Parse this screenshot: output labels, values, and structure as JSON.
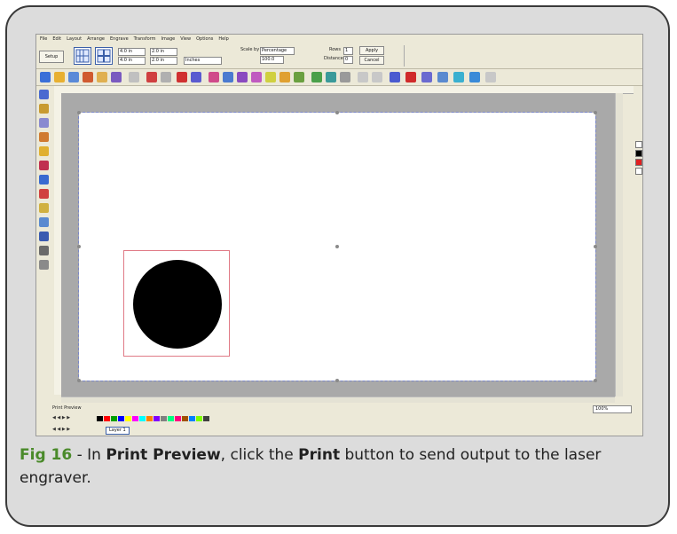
{
  "menu": [
    "File",
    "Edit",
    "Layout",
    "Arrange",
    "Engrave",
    "Transform",
    "Image",
    "View",
    "Options",
    "Help"
  ],
  "property_bar": {
    "setup_label": "Setup",
    "x_value": "4.0 in",
    "y_value": "4.0 in",
    "w_value": "2.0 in",
    "h_value": "2.0 in",
    "units_select": "Inches",
    "scale_by_label": "Scale by",
    "scale_select": "Percentage",
    "scale_value": "100.0",
    "rows_label": "Rows",
    "rows_value": "1",
    "distance_label": "Distance",
    "distance_value": "0",
    "apply_label": "Apply",
    "cancel_label": "Cancel"
  },
  "status": {
    "print_preview_label": "Print Preview",
    "zoom_value": "100%",
    "layer_tab": "Layer 1"
  },
  "palette": [
    "#000000",
    "#ff0000",
    "#00a000",
    "#0000ff",
    "#ffff00",
    "#ff00ff",
    "#00ffff",
    "#ff8000",
    "#8000ff",
    "#808080",
    "#00ff80",
    "#ff0080",
    "#a05000",
    "#0080ff",
    "#80ff00",
    "#404040"
  ],
  "caption": {
    "fig_label": "Fig 16",
    "text_1": " - In ",
    "bold_1": "Print Preview",
    "text_2": ", click the ",
    "bold_2": "Print",
    "text_3": " button to send output to the laser engraver."
  }
}
